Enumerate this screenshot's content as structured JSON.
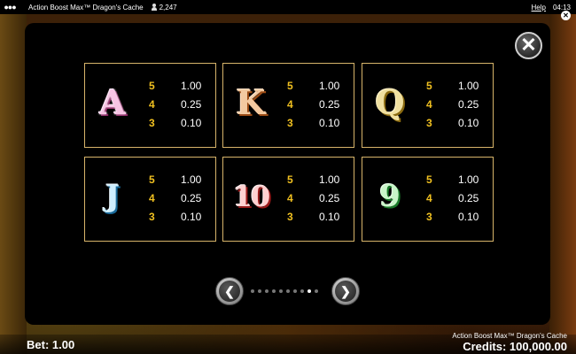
{
  "topbar": {
    "title": "Action Boost Max™ Dragon's Cache",
    "players": "2,247",
    "help": "Help",
    "time": "04:13"
  },
  "paytable": {
    "cards": [
      {
        "symbol": "A",
        "rows": [
          {
            "count": "5",
            "value": "1.00"
          },
          {
            "count": "4",
            "value": "0.25"
          },
          {
            "count": "3",
            "value": "0.10"
          }
        ]
      },
      {
        "symbol": "K",
        "rows": [
          {
            "count": "5",
            "value": "1.00"
          },
          {
            "count": "4",
            "value": "0.25"
          },
          {
            "count": "3",
            "value": "0.10"
          }
        ]
      },
      {
        "symbol": "Q",
        "rows": [
          {
            "count": "5",
            "value": "1.00"
          },
          {
            "count": "4",
            "value": "0.25"
          },
          {
            "count": "3",
            "value": "0.10"
          }
        ]
      },
      {
        "symbol": "J",
        "rows": [
          {
            "count": "5",
            "value": "1.00"
          },
          {
            "count": "4",
            "value": "0.25"
          },
          {
            "count": "3",
            "value": "0.10"
          }
        ]
      },
      {
        "symbol": "10",
        "rows": [
          {
            "count": "5",
            "value": "1.00"
          },
          {
            "count": "4",
            "value": "0.25"
          },
          {
            "count": "3",
            "value": "0.10"
          }
        ]
      },
      {
        "symbol": "9",
        "rows": [
          {
            "count": "5",
            "value": "1.00"
          },
          {
            "count": "4",
            "value": "0.25"
          },
          {
            "count": "3",
            "value": "0.10"
          }
        ]
      }
    ],
    "close_symbol": "✕",
    "prev_symbol": "❮",
    "next_symbol": "❯",
    "page_count": 10,
    "current_page": 9
  },
  "bottombar": {
    "bet": "Bet: 1.00",
    "brand": "Action Boost Max™ Dragon's Cache",
    "credits": "Credits: 100,000.00"
  },
  "colors": {
    "accent": "#f0c020",
    "card_border": "#d7b46a",
    "panel": "#000000"
  },
  "icons": {
    "menu": "menu-dots-icon",
    "players": "user-icon",
    "close": "close-icon",
    "prev": "arrow-left-icon",
    "next": "arrow-right-icon"
  }
}
